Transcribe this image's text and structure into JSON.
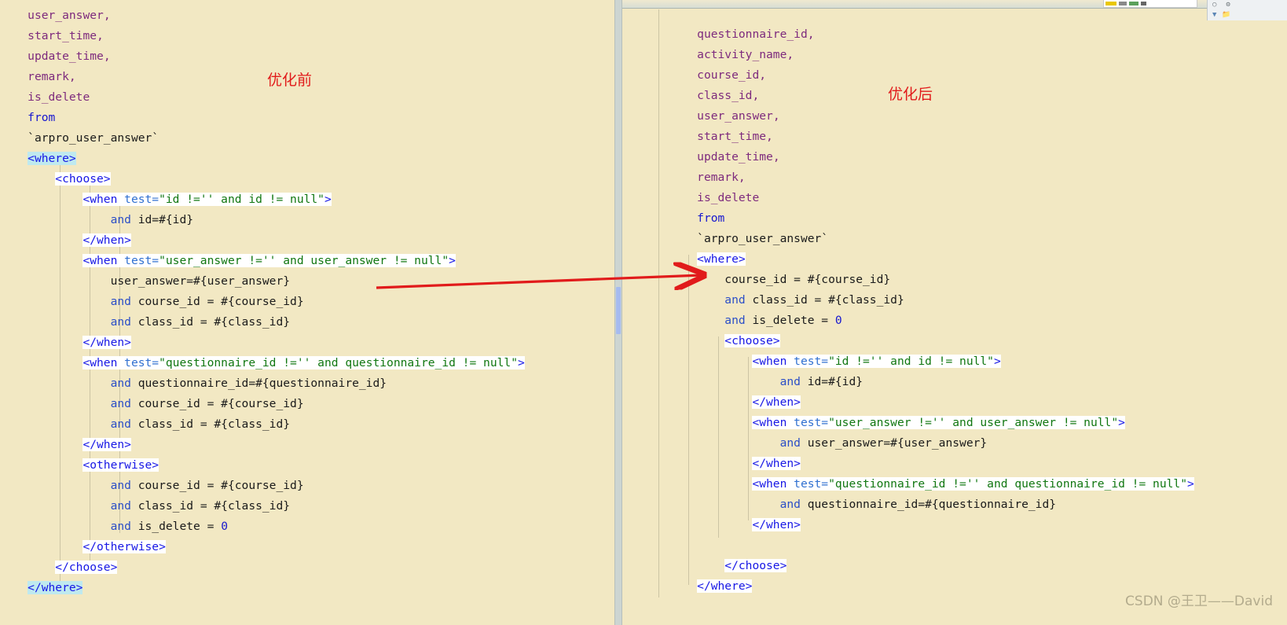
{
  "annotations": {
    "before_label": "优化前",
    "after_label": "优化后",
    "watermark": "CSDN @王卫——David",
    "arrow_color": "#e11b1b",
    "note_color": "#e11b1b"
  },
  "theme": {
    "editor_background": "#f2e8c3",
    "tag_background": "#ffffff",
    "selected_tag_background": "#bfe9ef",
    "identifier_color": "#7d2a7d",
    "keyword_color": "#1717cf",
    "tag_color": "#1717e5",
    "attribute_color": "#3070d0",
    "string_color": "#117711",
    "number_color": "#1717cf",
    "divider_color": "#cdd5d2",
    "scrollbar_thumb_color": "#9fb6f5"
  },
  "left_pane": {
    "name": "before-optimization-editor",
    "lines": [
      {
        "indent": 0,
        "segments": [
          {
            "t": "col",
            "v": "user_answer"
          },
          {
            "t": "punct",
            "v": ","
          }
        ]
      },
      {
        "indent": 0,
        "segments": [
          {
            "t": "col",
            "v": "start_time"
          },
          {
            "t": "punct",
            "v": ","
          }
        ]
      },
      {
        "indent": 0,
        "segments": [
          {
            "t": "col",
            "v": "update_time"
          },
          {
            "t": "punct",
            "v": ","
          }
        ]
      },
      {
        "indent": 0,
        "segments": [
          {
            "t": "col",
            "v": "remark"
          },
          {
            "t": "punct",
            "v": ","
          }
        ]
      },
      {
        "indent": 0,
        "segments": [
          {
            "t": "col",
            "v": "is_delete"
          }
        ]
      },
      {
        "indent": 0,
        "segments": [
          {
            "t": "kw",
            "v": "from"
          }
        ]
      },
      {
        "indent": 0,
        "segments": [
          {
            "t": "tick",
            "v": "`arpro_user_answer`"
          }
        ]
      },
      {
        "indent": 0,
        "segments": [
          {
            "t": "tagsel",
            "v": "<where>"
          }
        ]
      },
      {
        "indent": 1,
        "segments": [
          {
            "t": "tag",
            "v": "<choose>"
          }
        ]
      },
      {
        "indent": 2,
        "segments": [
          {
            "t": "tagopen",
            "v": "<when"
          },
          {
            "t": "attr",
            "v": " test="
          },
          {
            "t": "str",
            "v": "\"id !='' and id != null\""
          },
          {
            "t": "tagclose",
            "v": ">"
          }
        ]
      },
      {
        "indent": 3,
        "segments": [
          {
            "t": "and",
            "v": "and"
          },
          {
            "t": "plain",
            "v": " id=#{id}"
          }
        ]
      },
      {
        "indent": 2,
        "segments": [
          {
            "t": "tag",
            "v": "</when>"
          }
        ]
      },
      {
        "indent": 2,
        "segments": [
          {
            "t": "tagopen",
            "v": "<when"
          },
          {
            "t": "attr",
            "v": " test="
          },
          {
            "t": "str",
            "v": "\"user_answer !='' and user_answer != null\""
          },
          {
            "t": "tagclose",
            "v": ">"
          }
        ]
      },
      {
        "indent": 3,
        "segments": [
          {
            "t": "plain",
            "v": "user_answer=#{user_answer}"
          }
        ]
      },
      {
        "indent": 3,
        "segments": [
          {
            "t": "and",
            "v": "and"
          },
          {
            "t": "plain",
            "v": " course_id = #{course_id}"
          }
        ]
      },
      {
        "indent": 3,
        "segments": [
          {
            "t": "and",
            "v": "and"
          },
          {
            "t": "plain",
            "v": " class_id = #{class_id}"
          }
        ]
      },
      {
        "indent": 2,
        "segments": [
          {
            "t": "tag",
            "v": "</when>"
          }
        ]
      },
      {
        "indent": 2,
        "segments": [
          {
            "t": "tagopen",
            "v": "<when"
          },
          {
            "t": "attr",
            "v": " test="
          },
          {
            "t": "str",
            "v": "\"questionnaire_id !='' and questionnaire_id != null\""
          },
          {
            "t": "tagclose",
            "v": ">"
          }
        ]
      },
      {
        "indent": 3,
        "segments": [
          {
            "t": "and",
            "v": "and"
          },
          {
            "t": "plain",
            "v": " questionnaire_id=#{questionnaire_id}"
          }
        ]
      },
      {
        "indent": 3,
        "segments": [
          {
            "t": "and",
            "v": "and"
          },
          {
            "t": "plain",
            "v": " course_id = #{course_id}"
          }
        ]
      },
      {
        "indent": 3,
        "segments": [
          {
            "t": "and",
            "v": "and"
          },
          {
            "t": "plain",
            "v": " class_id = #{class_id}"
          }
        ]
      },
      {
        "indent": 2,
        "segments": [
          {
            "t": "tag",
            "v": "</when>"
          }
        ]
      },
      {
        "indent": 2,
        "segments": [
          {
            "t": "tag",
            "v": "<otherwise>"
          }
        ]
      },
      {
        "indent": 3,
        "segments": [
          {
            "t": "and",
            "v": "and"
          },
          {
            "t": "plain",
            "v": " course_id = #{course_id}"
          }
        ]
      },
      {
        "indent": 3,
        "segments": [
          {
            "t": "and",
            "v": "and"
          },
          {
            "t": "plain",
            "v": " class_id = #{class_id}"
          }
        ]
      },
      {
        "indent": 3,
        "segments": [
          {
            "t": "and",
            "v": "and"
          },
          {
            "t": "plain",
            "v": " is_delete = "
          },
          {
            "t": "num",
            "v": "0"
          }
        ]
      },
      {
        "indent": 2,
        "segments": [
          {
            "t": "tag",
            "v": "</otherwise>"
          }
        ]
      },
      {
        "indent": 1,
        "segments": [
          {
            "t": "tag",
            "v": "</choose>"
          }
        ]
      },
      {
        "indent": 0,
        "segments": [
          {
            "t": "tagsel",
            "v": "</where>"
          }
        ]
      }
    ]
  },
  "right_pane": {
    "name": "after-optimization-editor",
    "lines": [
      {
        "indent": 0,
        "segments": [
          {
            "t": "col",
            "v": "questionnaire_id"
          },
          {
            "t": "punct",
            "v": ","
          }
        ]
      },
      {
        "indent": 0,
        "segments": [
          {
            "t": "col",
            "v": "activity_name"
          },
          {
            "t": "punct",
            "v": ","
          }
        ]
      },
      {
        "indent": 0,
        "segments": [
          {
            "t": "col",
            "v": "course_id"
          },
          {
            "t": "punct",
            "v": ","
          }
        ]
      },
      {
        "indent": 0,
        "segments": [
          {
            "t": "col",
            "v": "class_id"
          },
          {
            "t": "punct",
            "v": ","
          }
        ]
      },
      {
        "indent": 0,
        "segments": [
          {
            "t": "col",
            "v": "user_answer"
          },
          {
            "t": "punct",
            "v": ","
          }
        ]
      },
      {
        "indent": 0,
        "segments": [
          {
            "t": "col",
            "v": "start_time"
          },
          {
            "t": "punct",
            "v": ","
          }
        ]
      },
      {
        "indent": 0,
        "segments": [
          {
            "t": "col",
            "v": "update_time"
          },
          {
            "t": "punct",
            "v": ","
          }
        ]
      },
      {
        "indent": 0,
        "segments": [
          {
            "t": "col",
            "v": "remark"
          },
          {
            "t": "punct",
            "v": ","
          }
        ]
      },
      {
        "indent": 0,
        "segments": [
          {
            "t": "col",
            "v": "is_delete"
          }
        ]
      },
      {
        "indent": 0,
        "segments": [
          {
            "t": "kw",
            "v": "from"
          }
        ]
      },
      {
        "indent": 0,
        "segments": [
          {
            "t": "tick",
            "v": "`arpro_user_answer`"
          }
        ]
      },
      {
        "indent": 0,
        "segments": [
          {
            "t": "tag",
            "v": "<where>"
          }
        ]
      },
      {
        "indent": 1,
        "segments": [
          {
            "t": "plain",
            "v": "course_id = #{course_id}"
          }
        ]
      },
      {
        "indent": 1,
        "segments": [
          {
            "t": "and",
            "v": "and"
          },
          {
            "t": "plain",
            "v": " class_id = #{class_id}"
          }
        ]
      },
      {
        "indent": 1,
        "segments": [
          {
            "t": "and",
            "v": "and"
          },
          {
            "t": "plain",
            "v": " is_delete = "
          },
          {
            "t": "num",
            "v": "0"
          }
        ]
      },
      {
        "indent": 1,
        "segments": [
          {
            "t": "tag",
            "v": "<choose>"
          }
        ]
      },
      {
        "indent": 2,
        "segments": [
          {
            "t": "tagopen",
            "v": "<when"
          },
          {
            "t": "attr",
            "v": " test="
          },
          {
            "t": "str",
            "v": "\"id !='' and id != null\""
          },
          {
            "t": "tagclose",
            "v": ">"
          }
        ]
      },
      {
        "indent": 3,
        "segments": [
          {
            "t": "and",
            "v": "and"
          },
          {
            "t": "plain",
            "v": " id=#{id}"
          }
        ]
      },
      {
        "indent": 2,
        "segments": [
          {
            "t": "tag",
            "v": "</when>"
          }
        ]
      },
      {
        "indent": 2,
        "segments": [
          {
            "t": "tagopen",
            "v": "<when"
          },
          {
            "t": "attr",
            "v": " test="
          },
          {
            "t": "str",
            "v": "\"user_answer !='' and user_answer != null\""
          },
          {
            "t": "tagclose",
            "v": ">"
          }
        ]
      },
      {
        "indent": 3,
        "segments": [
          {
            "t": "and",
            "v": "and"
          },
          {
            "t": "plain",
            "v": " user_answer=#{user_answer}"
          }
        ]
      },
      {
        "indent": 2,
        "segments": [
          {
            "t": "tag",
            "v": "</when>"
          }
        ]
      },
      {
        "indent": 2,
        "segments": [
          {
            "t": "tagopen",
            "v": "<when"
          },
          {
            "t": "attr",
            "v": " test="
          },
          {
            "t": "str",
            "v": "\"questionnaire_id !='' and questionnaire_id != null\""
          },
          {
            "t": "tagclose",
            "v": ">"
          }
        ]
      },
      {
        "indent": 3,
        "segments": [
          {
            "t": "and",
            "v": "and"
          },
          {
            "t": "plain",
            "v": " questionnaire_id=#{questionnaire_id}"
          }
        ]
      },
      {
        "indent": 2,
        "segments": [
          {
            "t": "tag",
            "v": "</when>"
          }
        ]
      },
      {
        "indent": 0,
        "segments": []
      },
      {
        "indent": 1,
        "segments": [
          {
            "t": "tag",
            "v": "</choose>"
          }
        ]
      },
      {
        "indent": 0,
        "segments": [
          {
            "t": "tag",
            "v": "</where>"
          }
        ]
      }
    ]
  }
}
